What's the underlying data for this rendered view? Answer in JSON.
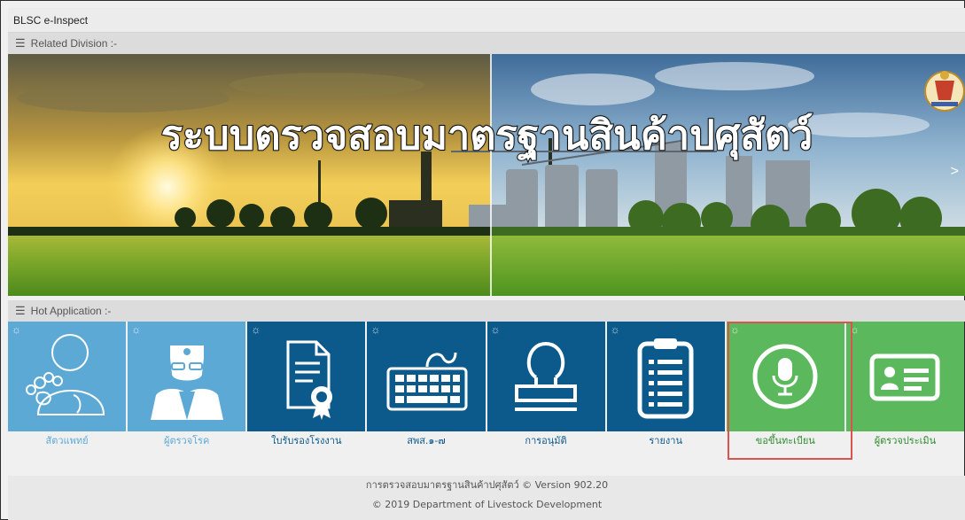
{
  "window": {
    "title": "BLSC e-Inspect"
  },
  "sections": {
    "related_division": "Related Division :-",
    "hot_application": "Hot Application :-"
  },
  "banner": {
    "title": "ระบบตรวจสอบมาตรฐานสินค้าปศุสัตว์",
    "next_glyph": ">"
  },
  "tiles": [
    {
      "label": "สัตวแพทย์",
      "icon": "veterinarian-icon",
      "bg": "#5da9d6",
      "label_color": "#5da9d6"
    },
    {
      "label": "ผู้ตรวจโรค",
      "icon": "disease-inspector-icon",
      "bg": "#5da9d6",
      "label_color": "#5da9d6"
    },
    {
      "label": "ใบรับรองโรงงาน",
      "icon": "factory-certificate-icon",
      "bg": "#0c5a8c",
      "label_color": "#0c5a8c"
    },
    {
      "label": "สพส.๑-๗",
      "icon": "keyboard-icon",
      "bg": "#0c5a8c",
      "label_color": "#0c5a8c"
    },
    {
      "label": "การอนุมัติ",
      "icon": "stamp-icon",
      "bg": "#0c5a8c",
      "label_color": "#0c5a8c"
    },
    {
      "label": "รายงาน",
      "icon": "report-clipboard-icon",
      "bg": "#0c5a8c",
      "label_color": "#0c5a8c"
    },
    {
      "label": "ขอขึ้นทะเบียน",
      "icon": "microphone-icon",
      "bg": "#5cb85c",
      "label_color": "#2e8b2e"
    },
    {
      "label": "ผู้ตรวจประเมิน",
      "icon": "id-card-icon",
      "bg": "#5cb85c",
      "label_color": "#2e8b2e"
    }
  ],
  "gear_glyph": "☼",
  "menu_glyph": "☰",
  "footer": {
    "line1": "การตรวจสอบมาตรฐานสินค้าปศุสัตว์ © Version 902.20",
    "line2": "© 2019 Department of Livestock Development"
  }
}
